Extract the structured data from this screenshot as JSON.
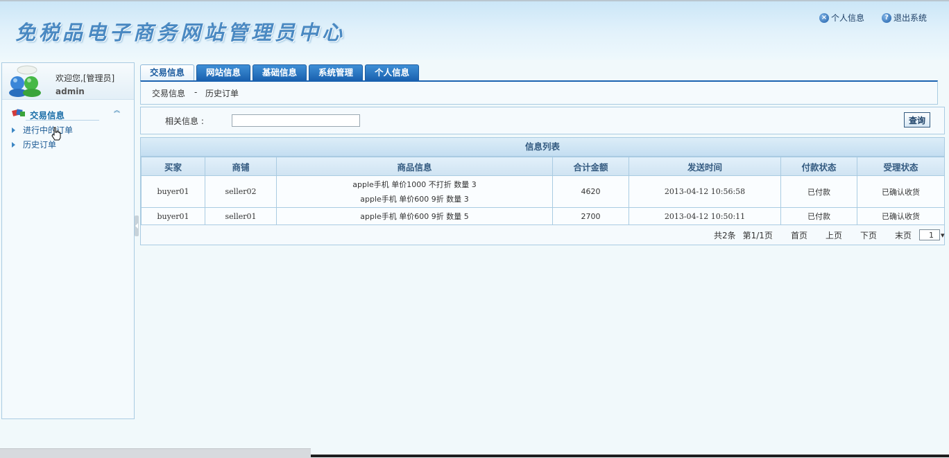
{
  "header": {
    "site_title": "免税品电子商务网站管理员中心",
    "profile_link": "个人信息",
    "logout_link": "退出系统",
    "profile_icon": "x-circle-icon",
    "logout_icon": "question-circle-icon"
  },
  "sidebar": {
    "welcome": "欢迎您,[管理员]",
    "username": "admin",
    "menu_header": "交易信息",
    "items": [
      {
        "label": "进行中的订单"
      },
      {
        "label": "历史订单"
      }
    ]
  },
  "tabs": [
    {
      "label": "交易信息",
      "active": true
    },
    {
      "label": "网站信息"
    },
    {
      "label": "基础信息"
    },
    {
      "label": "系统管理"
    },
    {
      "label": "个人信息"
    }
  ],
  "breadcrumb": {
    "section": "交易信息",
    "separator": "-",
    "page": "历史订单"
  },
  "search": {
    "label": "相关信息 :",
    "value": "",
    "button": "查询"
  },
  "list": {
    "title": "信息列表",
    "columns": [
      "买家",
      "商铺",
      "商品信息",
      "合计金额",
      "发送时间",
      "付款状态",
      "受理状态"
    ],
    "rows": [
      {
        "buyer": "buyer01",
        "shop": "seller02",
        "items": [
          "apple手机  单价1000  不打折 数量 3",
          "apple手机  单价600  9折   数量 3"
        ],
        "total": "4620",
        "time": "2013-04-12 10:56:58",
        "payment": "已付款",
        "status": "已确认收货"
      },
      {
        "buyer": "buyer01",
        "shop": "seller01",
        "items": [
          "apple手机  单价600  9折   数量 5"
        ],
        "total": "2700",
        "time": "2013-04-12 10:50:11",
        "payment": "已付款",
        "status": "已确认收货"
      }
    ]
  },
  "pager": {
    "summary": "共2条",
    "page_info": "第1/1页",
    "first": "首页",
    "prev": "上页",
    "next": "下页",
    "last": "末页",
    "current": "1"
  },
  "colors": {
    "accent": "#1b62b0",
    "border": "#a9cbe2",
    "title": "#4a89c2"
  }
}
